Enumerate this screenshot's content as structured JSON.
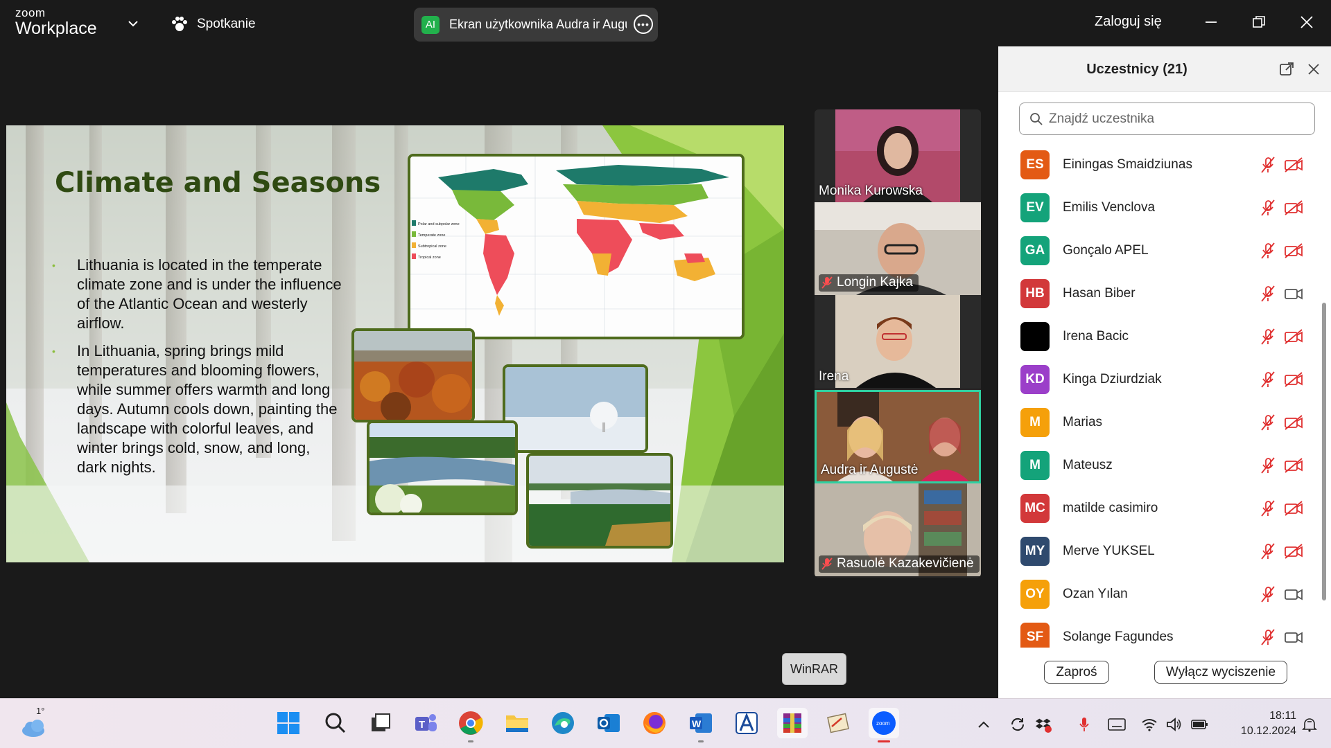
{
  "app": {
    "logo_line1": "zoom",
    "logo_line2": "Workplace",
    "meeting_label": "Spotkanie",
    "share_badge": "AI",
    "share_label": "Ekran użytkownika Audra ir Augustė",
    "login": "Zaloguj się",
    "accent": "#0b5cff"
  },
  "slide": {
    "title": "Climate and Seasons",
    "bullets": [
      "Lithuania is located in the temperate climate zone and is under the influence of the Atlantic Ocean and westerly airflow.",
      "In Lithuania, spring brings mild temperatures and blooming flowers, while summer offers warmth and long days. Autumn cools down, painting the landscape with colorful leaves, and winter brings cold, snow, and long, dark nights."
    ],
    "map_legend": [
      "Polar and subpolar zone",
      "Temperate zone",
      "Subtropical zone",
      "Tropical zone"
    ]
  },
  "gallery": [
    {
      "name": "Monika Kurowska",
      "muted": false,
      "active": false
    },
    {
      "name": "Longin Kajka",
      "muted": true,
      "active": false
    },
    {
      "name": "Irena",
      "muted": false,
      "active": false
    },
    {
      "name": "Audra ir Augustė",
      "muted": false,
      "active": true
    },
    {
      "name": "Rasuolė Kazakevičienė",
      "muted": true,
      "active": false
    }
  ],
  "winrar_tooltip": "WinRAR",
  "participants": {
    "title": "Uczestnicy (21)",
    "search_placeholder": "Znajdź uczestnika",
    "list": [
      {
        "initials": "ES",
        "name": "Einingas Smaidziunas",
        "color": "#e35a14",
        "video": "off"
      },
      {
        "initials": "EV",
        "name": "Emilis Venclova",
        "color": "#14a37a",
        "video": "off"
      },
      {
        "initials": "GA",
        "name": "Gonçalo APEL",
        "color": "#14a37a",
        "video": "off"
      },
      {
        "initials": "HB",
        "name": "Hasan Biber",
        "color": "#d2383a",
        "video": "on"
      },
      {
        "initials": "",
        "name": "Irena Bacic",
        "color": "#000000",
        "video": "off"
      },
      {
        "initials": "KD",
        "name": "Kinga Dziurdziak",
        "color": "#9b3fc9",
        "video": "off"
      },
      {
        "initials": "M",
        "name": "Marias",
        "color": "#f5a00a",
        "video": "off"
      },
      {
        "initials": "M",
        "name": "Mateusz",
        "color": "#14a37a",
        "video": "off"
      },
      {
        "initials": "MC",
        "name": "matilde casimiro",
        "color": "#d2383a",
        "video": "off"
      },
      {
        "initials": "MY",
        "name": "Merve YUKSEL",
        "color": "#2f4a6e",
        "video": "off"
      },
      {
        "initials": "OY",
        "name": "Ozan Yılan",
        "color": "#f5a00a",
        "video": "on"
      },
      {
        "initials": "SF",
        "name": "Solange Fagundes",
        "color": "#e35a14",
        "video": "on"
      }
    ],
    "invite": "Zaproś",
    "mute_all": "Wyłącz wyciszenie"
  },
  "taskbar": {
    "weather_temp": "1°",
    "time": "18:11",
    "date": "10.12.2024"
  }
}
